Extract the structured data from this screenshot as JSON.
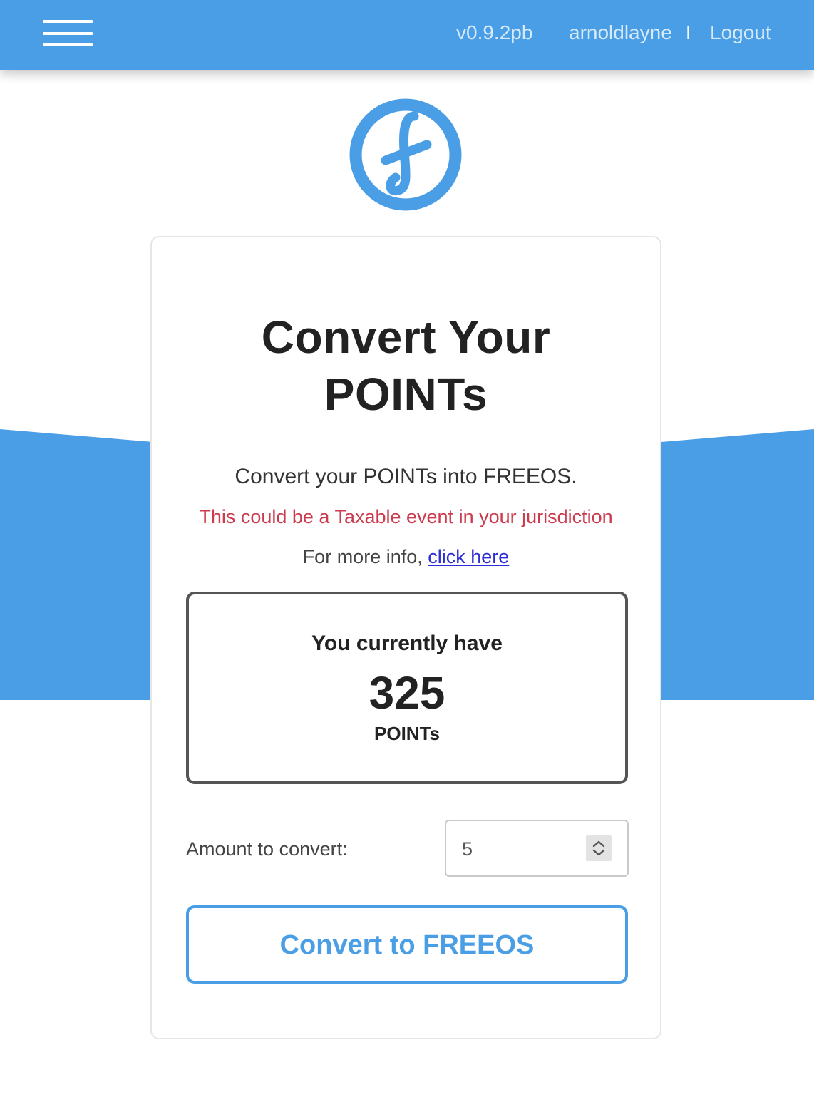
{
  "header": {
    "menu_icon": "hamburger-menu-icon",
    "version": "v0.9.2pb",
    "username": "arnoldlayne",
    "separator": "I",
    "logout_label": "Logout"
  },
  "logo": {
    "icon": "freeos-f-logo-icon"
  },
  "card": {
    "title_line1": "Convert Your",
    "title_line2": "POINTs",
    "subtitle": "Convert your POINTs into FREEOS.",
    "warning": "This could be a Taxable event in your jurisdiction",
    "more_info_prefix": "For more info, ",
    "more_info_link": "click here"
  },
  "balance": {
    "label": "You currently have",
    "value": "325",
    "unit": "POINTs"
  },
  "amount": {
    "label": "Amount to convert:",
    "value": "5",
    "stepper_icon": "up-down-stepper-icon"
  },
  "convert_button_label": "Convert to FREEOS",
  "colors": {
    "primary_blue": "#4a9ee6",
    "warning_red": "#cc3b4e",
    "link_blue": "#2d2dd6"
  }
}
